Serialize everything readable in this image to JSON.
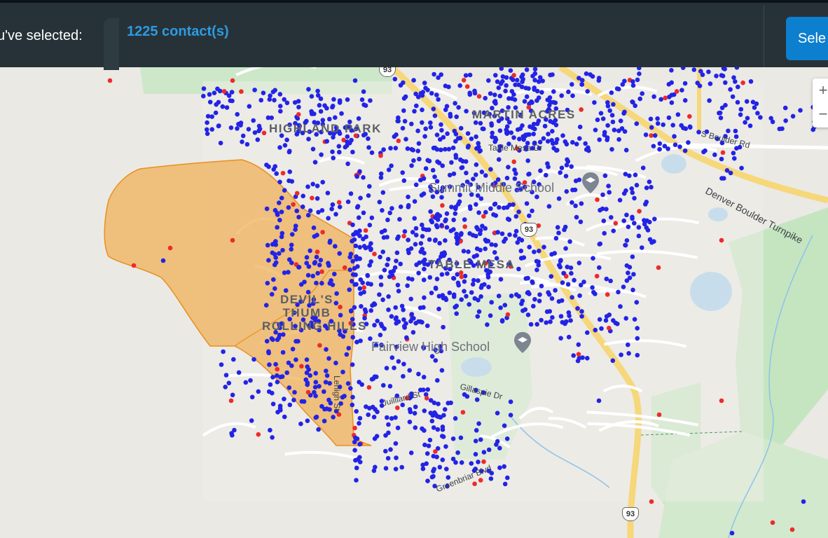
{
  "header": {
    "selected_label": "u've selected:",
    "contact_count": "1225 contact(s)",
    "select_button_label": "Sele"
  },
  "map": {
    "area_labels": [
      "HIGHLAND PARK",
      "MARTIN ACRES",
      "TABLE MESA",
      "DEVIL'S THUMB",
      "ROLLING HILLS"
    ],
    "poi_labels": [
      "Summit Middle School",
      "Fairview High School"
    ],
    "road_labels": [
      "Table Mesa Dr",
      "S Boulder Rd",
      "Denver Boulder Turnpike",
      "Greenbriar Blvd",
      "Juilliard St",
      "Gillaspie Dr",
      "Lehigh St"
    ],
    "route_shields": [
      "93",
      "93",
      "93"
    ],
    "colors": {
      "selection_fill": "#f0b05a",
      "selection_stroke": "#e8901e",
      "contact_dot": "#2323e6",
      "flagged_dot": "#ee2a2a",
      "header_bg": "#263238",
      "accent": "#2d9be0",
      "button": "#0d7fcf"
    },
    "zoom_controls": {
      "plus": "+",
      "minus": "−"
    }
  }
}
